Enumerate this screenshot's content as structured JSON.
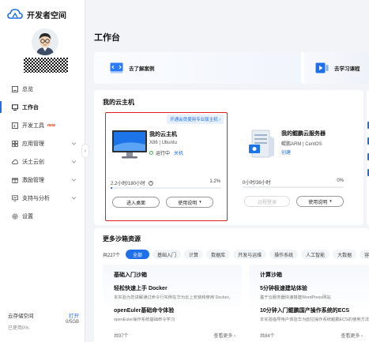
{
  "app": {
    "title": "开发者空间"
  },
  "sidebar": {
    "items": [
      {
        "label": "总览",
        "icon": "dashboard-icon"
      },
      {
        "label": "工作台",
        "icon": "desktop-icon",
        "active": true
      },
      {
        "label": "开发工具",
        "icon": "dev-tools-icon",
        "badge": "new"
      },
      {
        "label": "应用管理",
        "icon": "app-grid-icon"
      },
      {
        "label": "沃土云创",
        "icon": "cloud-rocket-icon"
      },
      {
        "label": "激励管理",
        "icon": "gift-icon"
      },
      {
        "label": "支持与分析",
        "icon": "monitor-icon"
      },
      {
        "label": "设置",
        "icon": "gear-icon"
      }
    ],
    "collapse_glyph": "‹",
    "storage": {
      "label": "云存储空间",
      "action": "打开",
      "quota": "0/5GB",
      "used": "已使用0%"
    }
  },
  "main": {
    "title": "工作台",
    "quick_links": [
      {
        "label": "去了解案例"
      },
      {
        "label": "去学习课程"
      }
    ],
    "cloud_hosts": {
      "title": "我的云主机",
      "peek_title": "我",
      "cards": [
        {
          "promo": "开通会员使用专业版主机",
          "promo_arrow": "›",
          "name": "我的云主机",
          "os": "X86 | Ubuntu",
          "status": "运行中",
          "status_action": "关机",
          "usage": "2.2小时/180小时",
          "percent_label": "1.2%",
          "percent": 1.2,
          "primary_button": "进入桌面",
          "guide_button": "使用说明"
        },
        {
          "name": "我的鲲鹏云服务器",
          "os": "鲲鹏ARM | CentOS",
          "status_action": "创建",
          "usage": "0小时/36小时",
          "percent_label": "0%",
          "percent": 0,
          "primary_button": "远程登录",
          "guide_button": "使用说明"
        }
      ]
    },
    "sandbox": {
      "title": "更多沙箱资源",
      "total": "共227个",
      "filters": [
        "全部",
        "基础入门",
        "计算",
        "数据库",
        "开发与运维",
        "操作系统",
        "人工智能",
        "大数据",
        "容器"
      ],
      "active_filter": "全部",
      "blocks": [
        {
          "title": "基础入门沙箱",
          "items": [
            {
              "title": "轻松快速上手 Docker",
              "desc": "本实验为您讲解通过命令行实例在华为云上安装和使用 Docker。"
            },
            {
              "title": "openEuler基础命令体验",
              "desc": "openEuler操作系统基础命令学习"
            }
          ],
          "count": "共97个",
          "more": "查看更多 ›"
        },
        {
          "title": "计算沙箱",
          "items": [
            {
              "title": "5分钟极速建站体验",
              "desc": "基于云服务器快速搭建WordPress网站"
            },
            {
              "title": "10分钟入门鲲鹏国产操作系统的ECS",
              "desc": "本实验指导用户体验华为欧拉操作系统鲲鹏ECS的使用方法。"
            }
          ],
          "count": "共84个",
          "more": "查看更多 ›"
        }
      ]
    }
  },
  "colors": {
    "accent": "#1f6feb",
    "highlight_border": "#e02020",
    "running": "#2db84d",
    "new_badge": "#e8380d"
  }
}
